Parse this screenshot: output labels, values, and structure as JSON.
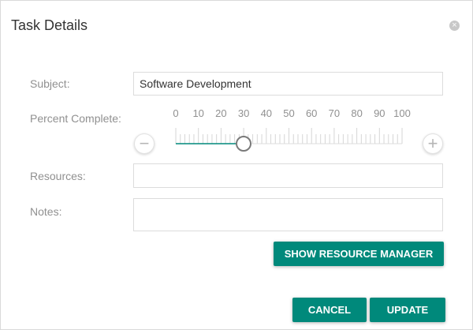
{
  "dialog": {
    "title": "Task Details",
    "close_icon": "close-circle-icon"
  },
  "form": {
    "subject_label": "Subject:",
    "subject_value": "Software Development",
    "percent_label": "Percent Complete:",
    "percent_value": 30,
    "percent_ticks": [
      "0",
      "10",
      "20",
      "30",
      "40",
      "50",
      "60",
      "70",
      "80",
      "90",
      "100"
    ],
    "decrease_symbol": "−",
    "increase_symbol": "+",
    "resources_label": "Resources:",
    "resources_value": "",
    "notes_label": "Notes:",
    "notes_value": ""
  },
  "buttons": {
    "show_resource_manager": "SHOW RESOURCE MANAGER",
    "cancel": "CANCEL",
    "update": "UPDATE"
  },
  "colors": {
    "accent": "#00897b",
    "slider_fill": "#00897b"
  }
}
